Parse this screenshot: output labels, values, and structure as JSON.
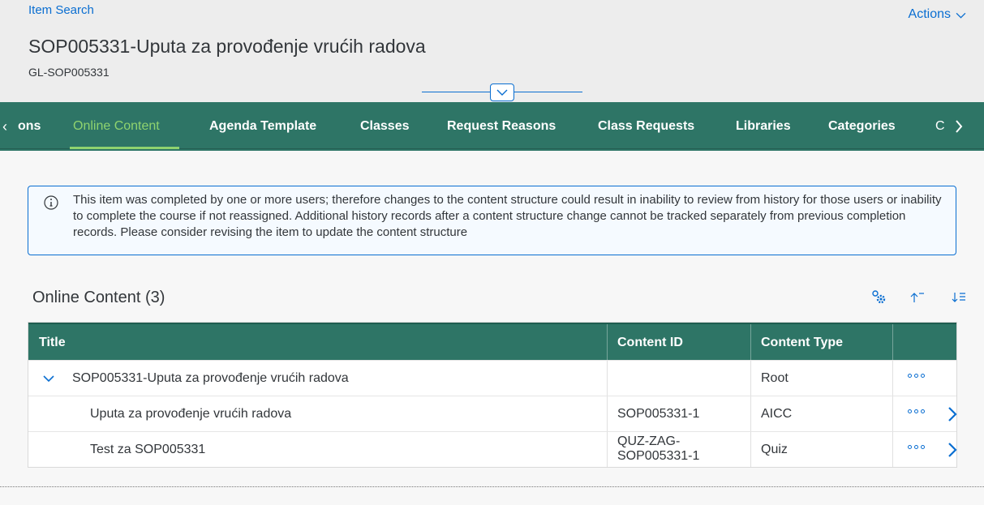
{
  "header": {
    "breadcrumb": "Item Search",
    "actions_label": "Actions",
    "title": "SOP005331-Uputa za provođenje vrućih radova",
    "subtitle": "GL-SOP005331"
  },
  "tabs": {
    "left_partial": "ons",
    "items": [
      {
        "label": "Online Content",
        "selected": true
      },
      {
        "label": "Agenda Template"
      },
      {
        "label": "Classes"
      },
      {
        "label": "Request Reasons"
      },
      {
        "label": "Class Requests"
      },
      {
        "label": "Libraries"
      },
      {
        "label": "Categories"
      }
    ],
    "right_partial": "C"
  },
  "info": {
    "text": "This item was completed by one or more users; therefore changes to the content structure could result in inability to review from history for those users or inability to complete the course if not reassigned. Additional history records after a content structure change cannot be tracked separately from previous completion records. Please consider revising the item to update the content structure"
  },
  "section": {
    "title": "Online Content (3)"
  },
  "table": {
    "columns": [
      "Title",
      "Content ID",
      "Content Type"
    ],
    "rows": [
      {
        "title": "SOP005331-Uputa za provođenje vrućih radova",
        "content_id": "",
        "content_type": "Root"
      },
      {
        "title": "Uputa za provođenje vrućih radova",
        "content_id": "SOP005331-1",
        "content_type": "AICC"
      },
      {
        "title": "Test za SOP005331",
        "content_id_line1": "QUZ-ZAG-",
        "content_id_line2": "SOP005331-1",
        "content_type": "Quiz"
      }
    ]
  },
  "colors": {
    "tab_bar": "#2e7566",
    "selected_tab": "#8fd36f",
    "link": "#0a6ed1"
  }
}
